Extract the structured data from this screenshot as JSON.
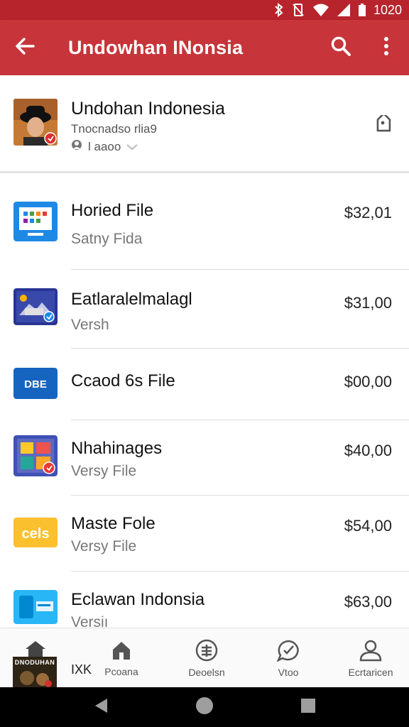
{
  "status_bar": {
    "time": "1020",
    "icons": [
      "bluetooth-icon",
      "vibrate-icon",
      "wifi-icon",
      "signal-icon",
      "battery-icon"
    ]
  },
  "app_bar": {
    "title": "Undowhan INonsia",
    "back_icon": "arrow-back-icon",
    "search_icon": "search-icon",
    "more_icon": "more-vert-icon",
    "color": "#c7343a"
  },
  "header": {
    "name": "Undohan Indonesia",
    "subtitle": "Tnocnadso rlia9",
    "meta": "l aaoo",
    "tag_icon": "tag-icon"
  },
  "items": [
    {
      "title": "Horied File",
      "subtitle": "Satny Fida",
      "price": "$32,01",
      "icon": "blue-app-icon"
    },
    {
      "title": "Eatlaralelmalagl",
      "subtitle": "Versh",
      "price": "$31,00",
      "icon": "image-app-icon"
    },
    {
      "title": "Ccaod 6s File",
      "subtitle": "",
      "price": "$00,00",
      "icon": "dbe-app-icon",
      "icon_text": "DBE"
    },
    {
      "title": "Nhahinages",
      "subtitle": "Versy File",
      "price": "$40,00",
      "icon": "images-app-icon"
    },
    {
      "title": "Maste Fole",
      "subtitle": "Versy File",
      "price": "$54,00",
      "icon": "yellow-app-icon",
      "icon_text": "cels"
    },
    {
      "title": "Eclawan Indonsia",
      "subtitle": "Versiı",
      "price": "$63,00",
      "icon": "cyan-app-icon"
    }
  ],
  "bottom_nav": {
    "profile_overlay": {
      "thumb_text": "DNODUHAN",
      "label": "IXK"
    },
    "items": [
      {
        "label": "Pcoana",
        "icon": "home-icon"
      },
      {
        "label": "Deoelsn",
        "icon": "list-circle-icon"
      },
      {
        "label": "Vtoo",
        "icon": "chat-check-icon"
      },
      {
        "label": "Ecrtaricen",
        "icon": "person-icon"
      }
    ]
  },
  "system_nav": {
    "back": "nav-back-icon",
    "home": "nav-home-icon",
    "recents": "nav-recents-icon"
  }
}
